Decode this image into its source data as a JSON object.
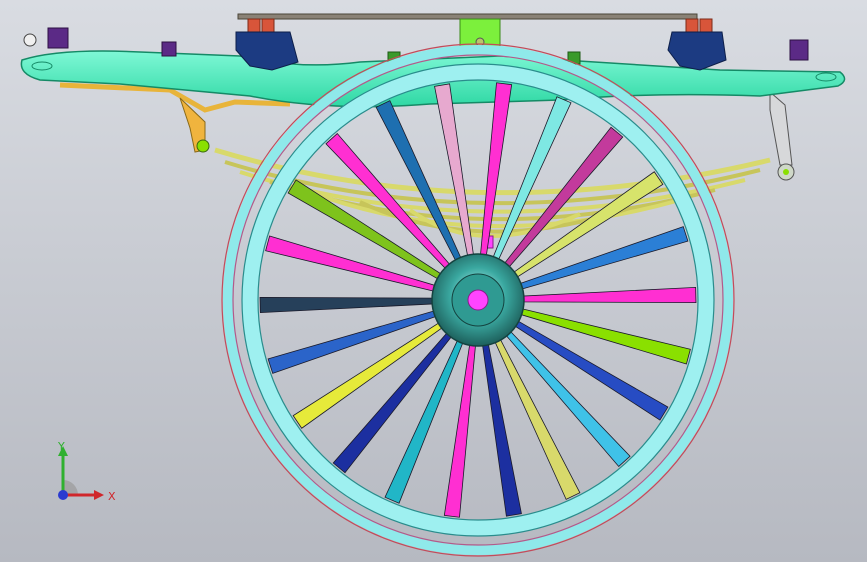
{
  "app": {
    "view": "cad-model-viewport"
  },
  "colors": {
    "background_top": "#d9dce2",
    "background_bottom": "#b6b9c1",
    "frame": "#5ef0c0",
    "rim_outer": "#8fe9ea",
    "rim_inner": "#c9f4f6",
    "hub": "#2e8c86",
    "axle": "#ff44ff",
    "leaf_spring": "#d8d96b",
    "top_bar": "#8a8276",
    "spring_coil": "#d8553a",
    "bracket_dark": "#1c3b82",
    "clamp_purple": "#5b2a86"
  },
  "spoke_colors": [
    "#ff2fd2",
    "#7ee8e3",
    "#c33a9c",
    "#d7e36b",
    "#2b7fd6",
    "#ff2fd2",
    "#8ae000",
    "#274cc3",
    "#3fc2e8",
    "#d8d96b",
    "#1c2fa0",
    "#ff2fd2",
    "#21b6c7",
    "#1c2fa0",
    "#e6ea3a",
    "#2b64c9",
    "#26405a",
    "#ff2fd2",
    "#7ec31c",
    "#ff2fd2",
    "#1e6fb0",
    "#e7a9cf"
  ],
  "triad": {
    "y_label": "Y",
    "x_label": "X"
  }
}
